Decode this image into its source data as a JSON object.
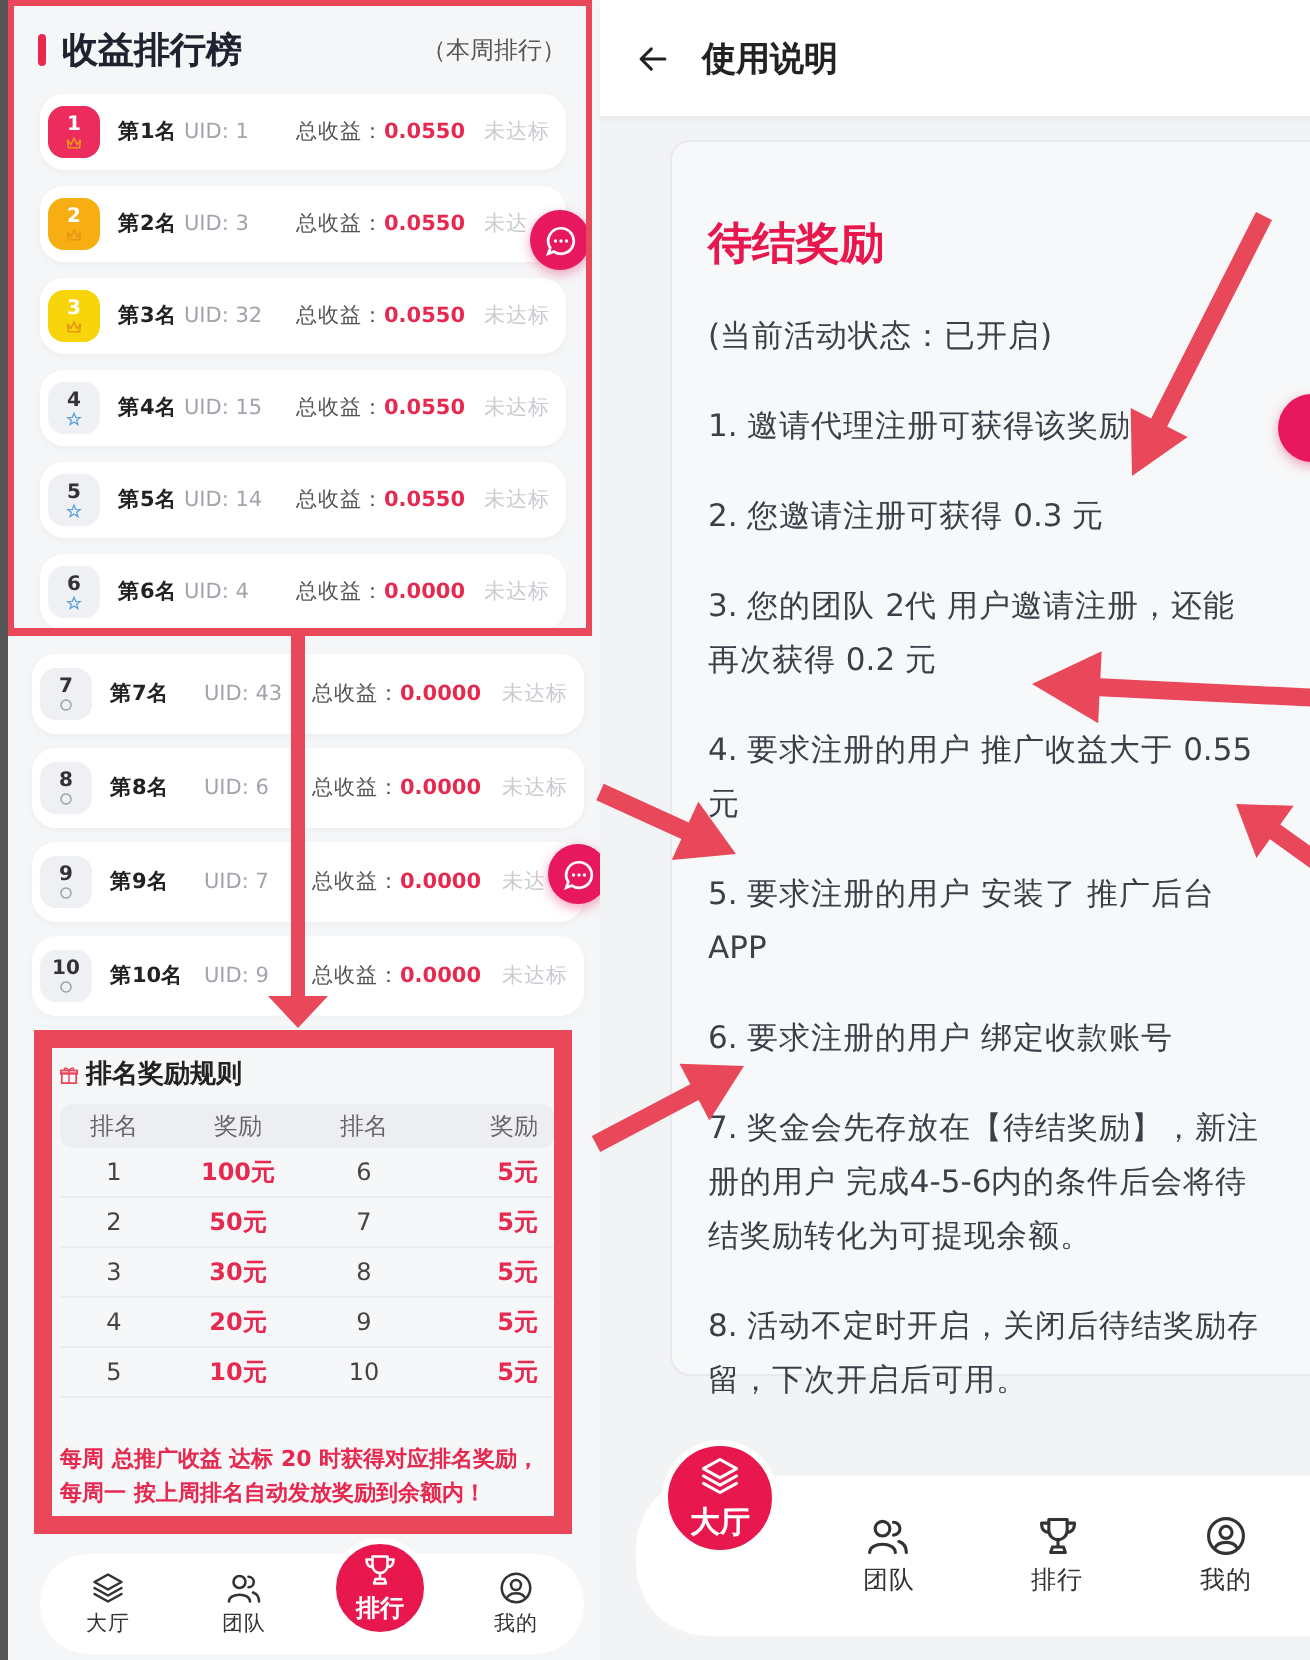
{
  "ranking_screen": {
    "title": "收益排行榜",
    "subtitle": "（本周排行）",
    "rankings": [
      {
        "badge": "1",
        "kind": "crown",
        "color": "#ec2c5c",
        "rank": "第1名",
        "uid": "UID: 1",
        "earnings_label": "总收益：",
        "earnings": "0.0550",
        "status": "未达标"
      },
      {
        "badge": "2",
        "kind": "crown",
        "color": "#f6ae12",
        "rank": "第2名",
        "uid": "UID: 3",
        "earnings_label": "总收益：",
        "earnings": "0.0550",
        "status": "未达"
      },
      {
        "badge": "3",
        "kind": "crown",
        "color": "#f8d40a",
        "rank": "第3名",
        "uid": "UID: 32",
        "earnings_label": "总收益：",
        "earnings": "0.0550",
        "status": "未达标"
      },
      {
        "badge": "4",
        "kind": "star",
        "color": "#eef0f4",
        "rank": "第4名",
        "uid": "UID: 15",
        "earnings_label": "总收益：",
        "earnings": "0.0550",
        "status": "未达标"
      },
      {
        "badge": "5",
        "kind": "star",
        "color": "#eef0f4",
        "rank": "第5名",
        "uid": "UID: 14",
        "earnings_label": "总收益：",
        "earnings": "0.0550",
        "status": "未达标"
      },
      {
        "badge": "6",
        "kind": "star",
        "color": "#eef0f4",
        "rank": "第6名",
        "uid": "UID: 4",
        "earnings_label": "总收益：",
        "earnings": "0.0000",
        "status": "未达标"
      },
      {
        "badge": "7",
        "kind": "circle",
        "color": "#eef0f4",
        "rank": "第7名",
        "uid": "UID: 43",
        "earnings_label": "总收益：",
        "earnings": "0.0000",
        "status": "未达标"
      },
      {
        "badge": "8",
        "kind": "circle",
        "color": "#eef0f4",
        "rank": "第8名",
        "uid": "UID: 6",
        "earnings_label": "总收益：",
        "earnings": "0.0000",
        "status": "未达标"
      },
      {
        "badge": "9",
        "kind": "circle",
        "color": "#eef0f4",
        "rank": "第9名",
        "uid": "UID: 7",
        "earnings_label": "总收益：",
        "earnings": "0.0000",
        "status": "未达"
      },
      {
        "badge": "10",
        "kind": "circle",
        "color": "#eef0f4",
        "rank": "第10名",
        "uid": "UID: 9",
        "earnings_label": "总收益：",
        "earnings": "0.0000",
        "status": "未达标"
      }
    ],
    "rules": {
      "title": "排名奖励规则",
      "columns": [
        "排名",
        "奖励",
        "排名",
        "奖励"
      ],
      "rows": [
        [
          "1",
          "100元",
          "6",
          "5元"
        ],
        [
          "2",
          "50元",
          "7",
          "5元"
        ],
        [
          "3",
          "30元",
          "8",
          "5元"
        ],
        [
          "4",
          "20元",
          "9",
          "5元"
        ],
        [
          "5",
          "10元",
          "10",
          "5元"
        ]
      ],
      "note": "每周 总推广收益 达标 20 时获得对应排名奖励，每周一 按上周排名自动发放奖励到余额内！"
    },
    "nav": [
      {
        "label": "大厅",
        "selected": false
      },
      {
        "label": "团队",
        "selected": false
      },
      {
        "label": "排行",
        "selected": true
      },
      {
        "label": "我的",
        "selected": false
      }
    ]
  },
  "instructions_screen": {
    "title": "使用说明",
    "heading": "待结奖励",
    "status": "(当前活动状态：已开启)",
    "items": [
      "1. 邀请代理注册可获得该奖励",
      "2. 您邀请注册可获得 0.3 元",
      "3. 您的团队 2代 用户邀请注册，还能再次获得 0.2 元",
      "4. 要求注册的用户 推广收益大于 0.55 元",
      "5. 要求注册的用户 安装了 推广后台 APP",
      "6. 要求注册的用户 绑定收款账号",
      "7. 奖金会先存放在【待结奖励】，新注册的用户 完成4-5-6内的条件后会将待结奖励转化为可提现余额。",
      "8. 活动不定时开启，关闭后待结奖励存留，下次开启后可用。"
    ],
    "nav": [
      {
        "label": "大厅",
        "selected": true
      },
      {
        "label": "团队",
        "selected": false
      },
      {
        "label": "排行",
        "selected": false
      },
      {
        "label": "我的",
        "selected": false
      }
    ]
  }
}
